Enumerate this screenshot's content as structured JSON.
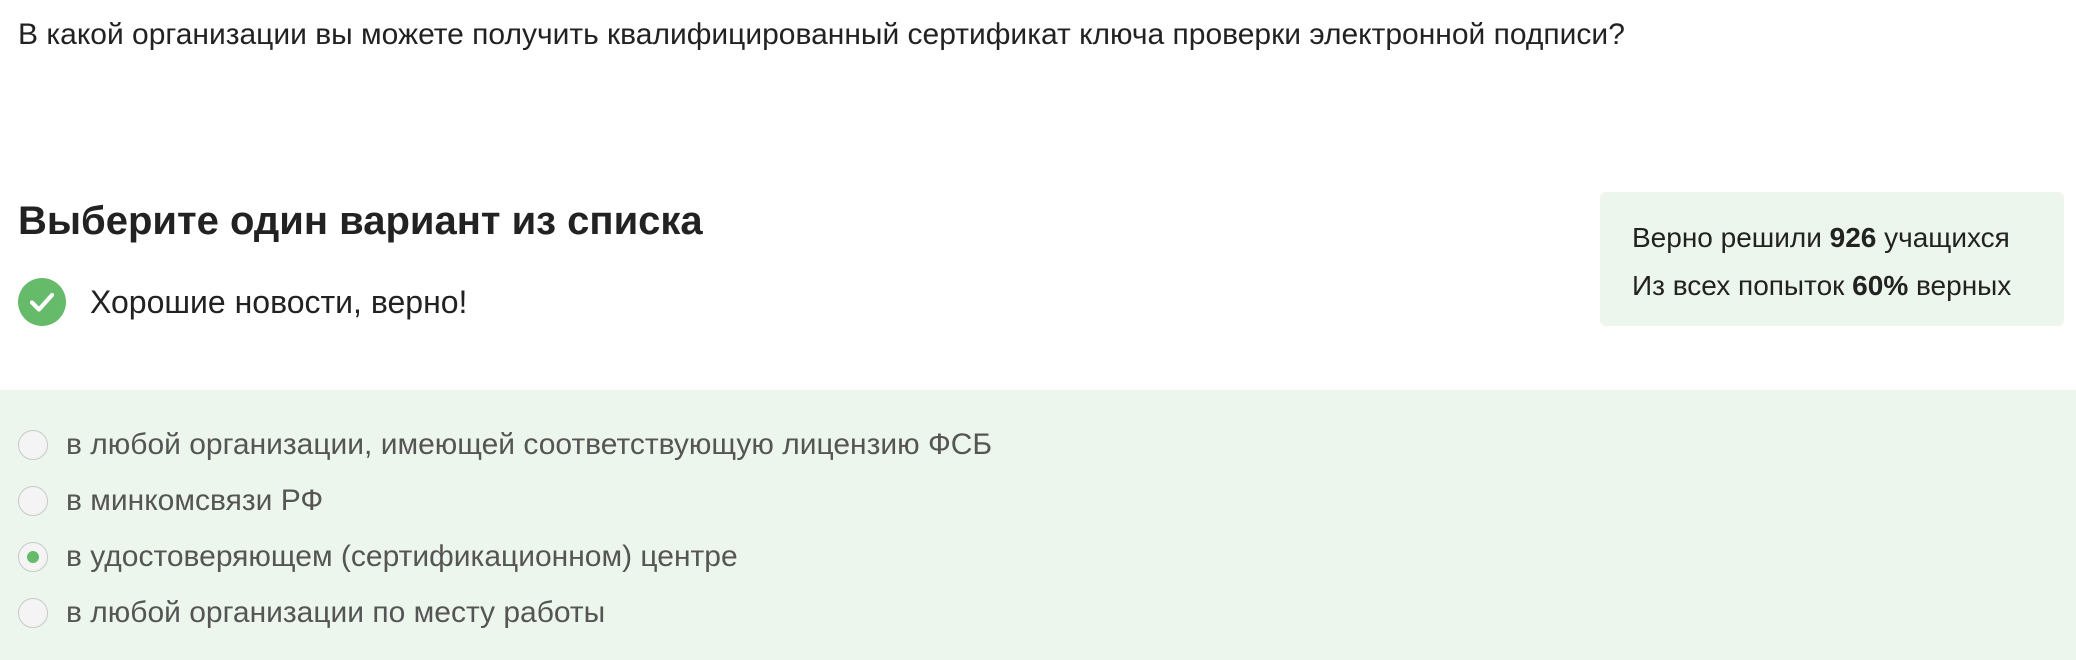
{
  "question": {
    "text": "В какой организации вы можете получить квалифицированный сертификат ключа проверки электронной подписи?"
  },
  "task": {
    "title": "Выберите один вариант из списка"
  },
  "feedback": {
    "icon": "check-circle-icon",
    "text": "Хорошие новости, верно!",
    "color": "#66bb6a"
  },
  "stats": {
    "line1_prefix": "Верно решили ",
    "solved_count": "926",
    "line1_suffix": " учащихся",
    "line2_prefix": "Из всех попыток ",
    "correct_percent": "60%",
    "line2_suffix": " верных",
    "background": "#edf6ec"
  },
  "options": {
    "background": "#edf6ec",
    "items": [
      {
        "label": "в любой организации, имеющей соответствующую лицензию ФСБ",
        "selected": false
      },
      {
        "label": "в минкомсвязи РФ",
        "selected": false
      },
      {
        "label": "в удостоверяющем (сертификационном) центре",
        "selected": true
      },
      {
        "label": "в любой организации по месту работы",
        "selected": false
      }
    ]
  }
}
